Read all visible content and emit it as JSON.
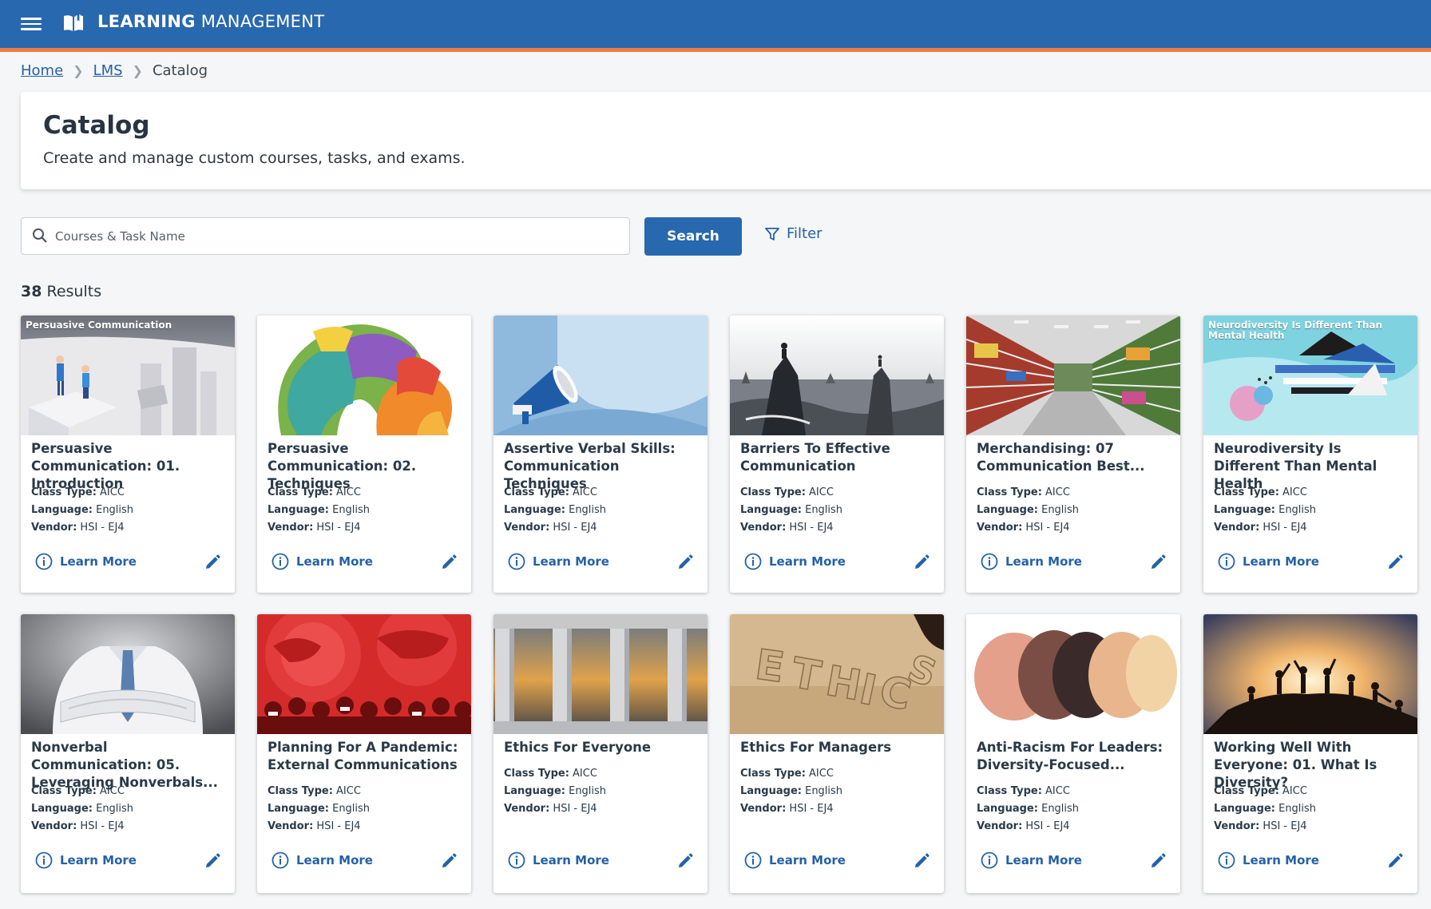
{
  "app": {
    "title_bold": "LEARNING",
    "title_rest": " MANAGEMENT"
  },
  "breadcrumb": {
    "home": "Home",
    "lms": "LMS",
    "current": "Catalog"
  },
  "header": {
    "title": "Catalog",
    "subtitle": "Create and manage custom courses, tasks, and exams."
  },
  "search": {
    "placeholder": "Courses & Task Name",
    "button": "Search",
    "filter": "Filter"
  },
  "results": {
    "count": "38",
    "label": " Results"
  },
  "meta_labels": {
    "class_type": "Class Type:",
    "language": "Language:",
    "vendor": "Vendor:"
  },
  "learn_more": "Learn More",
  "cards": [
    {
      "title": "Persuasive Communication: 01. Introduction",
      "caption": "Persuasive Communication",
      "class_type": " AICC",
      "language": " English",
      "vendor": " HSI - EJ4"
    },
    {
      "title": "Persuasive Communication: 02. Techniques",
      "caption": "",
      "class_type": " AICC",
      "language": " English",
      "vendor": " HSI - EJ4"
    },
    {
      "title": "Assertive Verbal Skills: Communication Techniques",
      "caption": "",
      "class_type": " AICC",
      "language": " English",
      "vendor": " HSI - EJ4"
    },
    {
      "title": "Barriers To Effective Communication",
      "caption": "",
      "class_type": " AICC",
      "language": " English",
      "vendor": " HSI - EJ4"
    },
    {
      "title": "Merchandising: 07 Communication Best...",
      "caption": "",
      "class_type": " AICC",
      "language": " English",
      "vendor": " HSI - EJ4"
    },
    {
      "title": "Neurodiversity Is Different Than Mental Health",
      "caption": "Neurodiversity Is Different Than Mental Health",
      "class_type": " AICC",
      "language": " English",
      "vendor": " HSI - EJ4"
    },
    {
      "title": "Nonverbal Communication: 05. Leveraging Nonverbals...",
      "caption": "",
      "class_type": " AICC",
      "language": " English",
      "vendor": " HSI - EJ4"
    },
    {
      "title": "Planning For A Pandemic: External Communications",
      "caption": "",
      "class_type": " AICC",
      "language": " English",
      "vendor": " HSI - EJ4"
    },
    {
      "title": "Ethics For Everyone",
      "caption": "",
      "class_type": " AICC",
      "language": " English",
      "vendor": " HSI - EJ4"
    },
    {
      "title": "Ethics For Managers",
      "caption": "",
      "class_type": " AICC",
      "language": " English",
      "vendor": " HSI - EJ4"
    },
    {
      "title": "Anti-Racism For Leaders: Diversity-Focused...",
      "caption": "",
      "class_type": " AICC",
      "language": " English",
      "vendor": " HSI - EJ4"
    },
    {
      "title": "Working Well With Everyone: 01. What Is Diversity?",
      "caption": "",
      "class_type": " AICC",
      "language": " English",
      "vendor": " HSI - EJ4"
    }
  ],
  "image_art": {
    "persuasive-intro": "3d-figures-on-pedestal",
    "persuasive-techniques": "watercolor-heads",
    "assertive": "megaphone",
    "barriers": "rocks-in-sea",
    "merchandising": "supermarket-aisle",
    "neurodiversity": "abstract-triangles",
    "nonverbal": "businessman-arms-crossed",
    "pandemic": "red-world-map-crowd",
    "ethics-everyone": "columns-sunset",
    "ethics-managers": "ethics-letters-sand",
    "anti-racism": "skin-tone-swatches",
    "working-well": "team-silhouettes-sunset"
  }
}
